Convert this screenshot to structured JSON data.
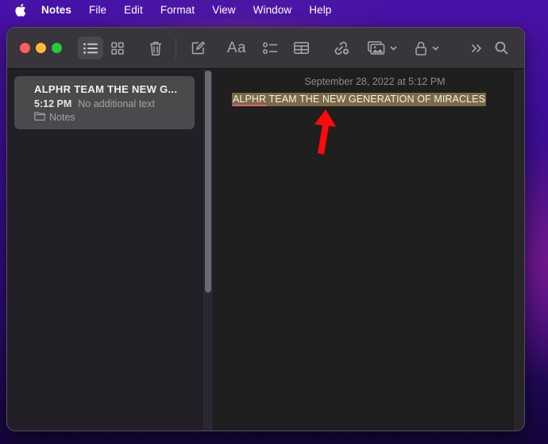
{
  "menubar": {
    "apple_icon": "apple-logo-icon",
    "items": [
      {
        "label": "Notes",
        "is_app": true
      },
      {
        "label": "File"
      },
      {
        "label": "Edit"
      },
      {
        "label": "Format"
      },
      {
        "label": "View"
      },
      {
        "label": "Window"
      },
      {
        "label": "Help"
      }
    ]
  },
  "toolbar": {
    "traffic_lights": [
      "close",
      "minimize",
      "zoom"
    ],
    "buttons": [
      {
        "name": "list-view",
        "icon": "list-icon",
        "active": true
      },
      {
        "name": "gallery-view",
        "icon": "grid-icon"
      },
      {
        "name": "delete",
        "icon": "trash-icon"
      },
      {
        "name": "new-note",
        "icon": "compose-icon"
      },
      {
        "name": "format",
        "icon": "text-format-icon",
        "label": "Aa"
      },
      {
        "name": "checklist",
        "icon": "checklist-icon"
      },
      {
        "name": "table",
        "icon": "table-icon"
      },
      {
        "name": "collaborate",
        "icon": "link-collaborate-icon"
      },
      {
        "name": "media",
        "icon": "photo-icon",
        "has_dropdown": true
      },
      {
        "name": "lock",
        "icon": "lock-icon",
        "has_dropdown": true
      },
      {
        "name": "more",
        "icon": "chevron-double-right-icon"
      },
      {
        "name": "search",
        "icon": "search-icon"
      }
    ]
  },
  "sidebar": {
    "notes": [
      {
        "title": "ALPHR TEAM THE NEW G...",
        "time": "5:12 PM",
        "preview": "No additional text",
        "folder": "Notes",
        "selected": true
      }
    ]
  },
  "editor": {
    "date": "September 28, 2022 at 5:12 PM",
    "content_misspelled": "ALPHR",
    "content_rest": " TEAM THE NEW GENERATION OF MIRACLES",
    "highlight_color": "#7a6a47",
    "annotation": {
      "type": "arrow",
      "color": "#ff0a0a",
      "points_to": "note-text"
    }
  }
}
